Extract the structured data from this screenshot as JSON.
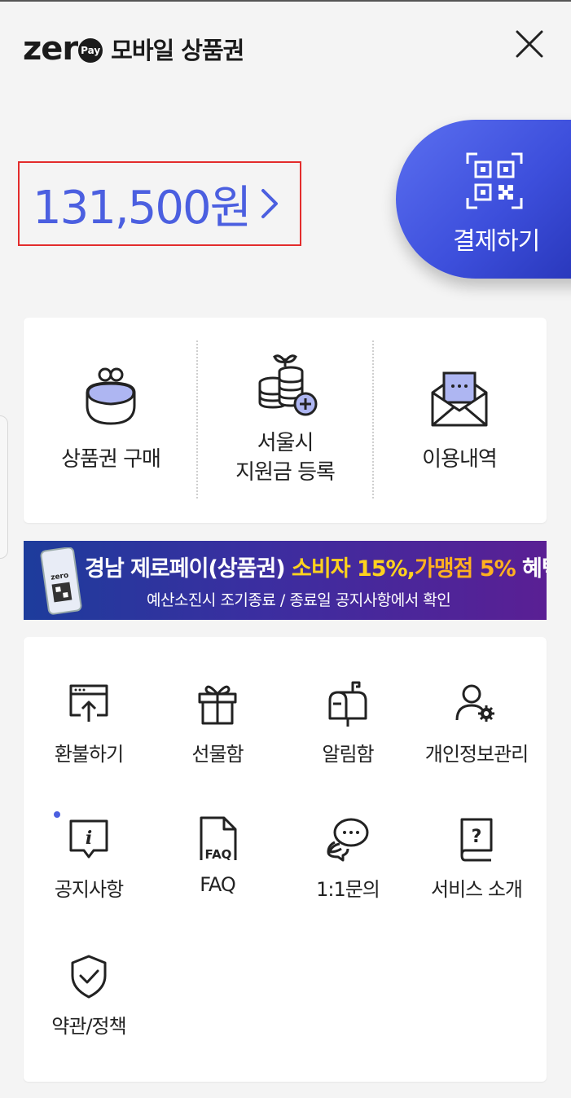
{
  "header": {
    "logo_text": "zer",
    "logo_badge": "Pay",
    "title": "모바일 상품권"
  },
  "balance": {
    "amount": "131,500원"
  },
  "pay_button": {
    "label": "결제하기"
  },
  "quick_menu": [
    {
      "label": "상품권 구매",
      "icon": "coin-purse-icon"
    },
    {
      "label": "서울시\n지원금 등록",
      "icon": "coin-stack-plus-icon"
    },
    {
      "label": "이용내역",
      "icon": "envelope-icon"
    }
  ],
  "banner": {
    "phone_text": "zero",
    "main_part1": "경남 제로페이(상품권) ",
    "main_part2": "소비자 15%,",
    "main_part3": "가맹점 5%",
    "main_part4": " 혜택",
    "sub": "예산소진시 조기종료 / 종료일 공지사항에서 확인"
  },
  "menu": [
    {
      "label": "환불하기",
      "icon": "refund-upload-icon"
    },
    {
      "label": "선물함",
      "icon": "gift-icon"
    },
    {
      "label": "알림함",
      "icon": "mailbox-icon"
    },
    {
      "label": "개인정보관리",
      "icon": "user-settings-icon"
    },
    {
      "label": "공지사항",
      "icon": "info-bubble-icon"
    },
    {
      "label": "FAQ",
      "icon": "faq-document-icon",
      "icon_text": "FAQ"
    },
    {
      "label": "1:1문의",
      "icon": "chat-bubbles-icon"
    },
    {
      "label": "서비스 소개",
      "icon": "question-book-icon",
      "icon_text": "?"
    },
    {
      "label": "약관/정책",
      "icon": "shield-check-icon"
    }
  ],
  "colors": {
    "accent": "#4b5fe0",
    "highlight_box": "#e32c2c",
    "banner_yellow": "#ffd21e"
  }
}
